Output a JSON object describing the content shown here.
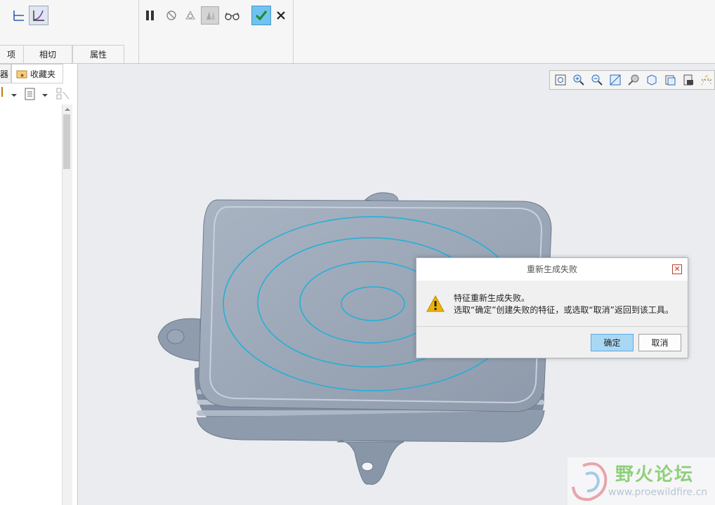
{
  "ribbon": {
    "tabs": [
      "项",
      "相切",
      "属性"
    ]
  },
  "left_panel": {
    "tab_partial": "器",
    "tab_favorites": "收藏夹"
  },
  "dialog": {
    "title": "重新生成失败",
    "message_line1": "特征重新生成失败。",
    "message_line2": "选取“确定”创建失败的特征，或选取“取消”返回到该工具。",
    "ok_label": "确定",
    "cancel_label": "取消",
    "close_glyph": "✕"
  },
  "watermark": {
    "title": "野火论坛",
    "url": "www.proewildfire.cn"
  },
  "colors": {
    "accent": "#5aa9e6",
    "model": "#9aa7b8",
    "curve": "#1fb0d8",
    "warning": "#f0b400"
  }
}
